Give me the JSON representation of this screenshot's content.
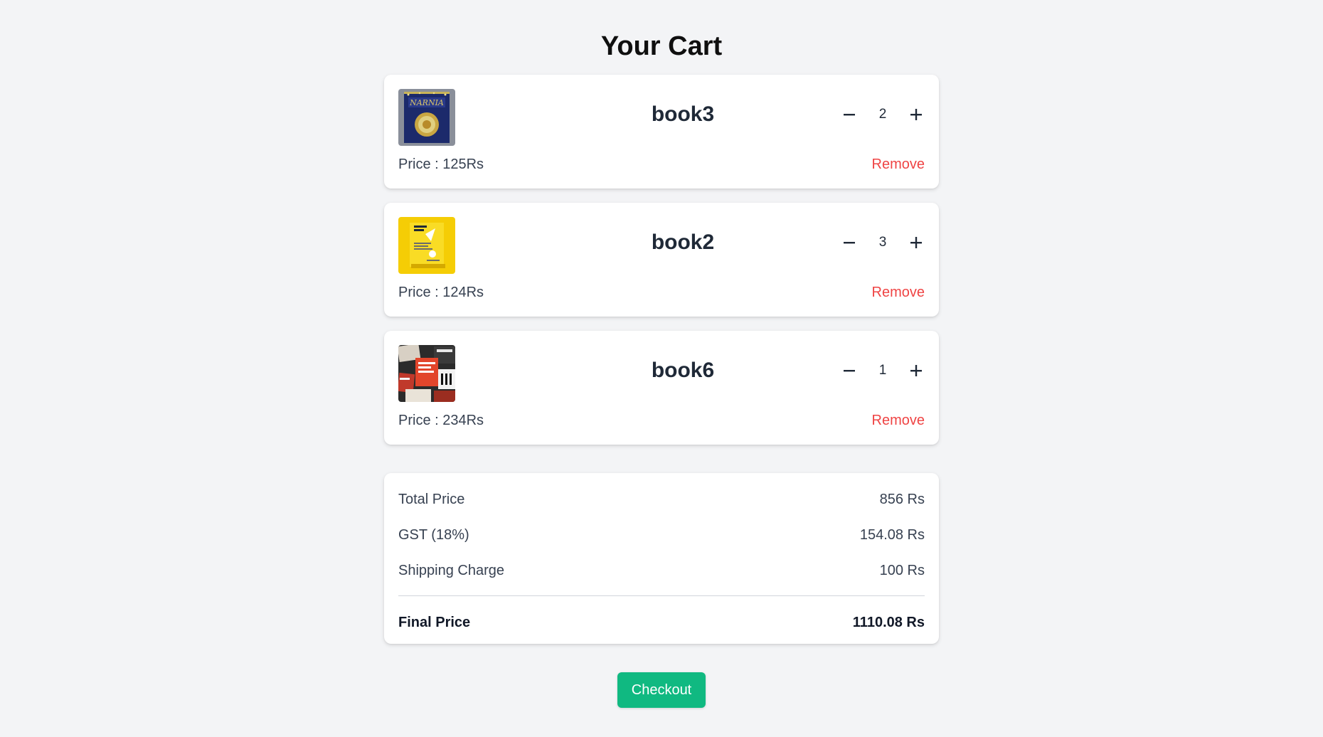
{
  "page": {
    "title": "Your Cart"
  },
  "cart": {
    "items": [
      {
        "name": "book3",
        "quantity": "2",
        "price_label": "Price : 125Rs",
        "remove_label": "Remove",
        "thumbnail": "book-cover-narnia"
      },
      {
        "name": "book2",
        "quantity": "3",
        "price_label": "Price : 124Rs",
        "remove_label": "Remove",
        "thumbnail": "book-cover-yellow"
      },
      {
        "name": "book6",
        "quantity": "1",
        "price_label": "Price : 234Rs",
        "remove_label": "Remove",
        "thumbnail": "book-cover-collage"
      }
    ]
  },
  "summary": {
    "total_label": "Total Price",
    "total_value": "856 Rs",
    "gst_label": "GST (18%)",
    "gst_value": "154.08 Rs",
    "shipping_label": "Shipping Charge",
    "shipping_value": "100 Rs",
    "final_label": "Final Price",
    "final_value": "1110.08 Rs"
  },
  "actions": {
    "checkout_label": "Checkout"
  },
  "colors": {
    "background": "#f3f4f6",
    "remove": "#ef4444",
    "checkout": "#10b981"
  },
  "icons": {
    "decrease": "minus-icon",
    "increase": "plus-icon"
  }
}
